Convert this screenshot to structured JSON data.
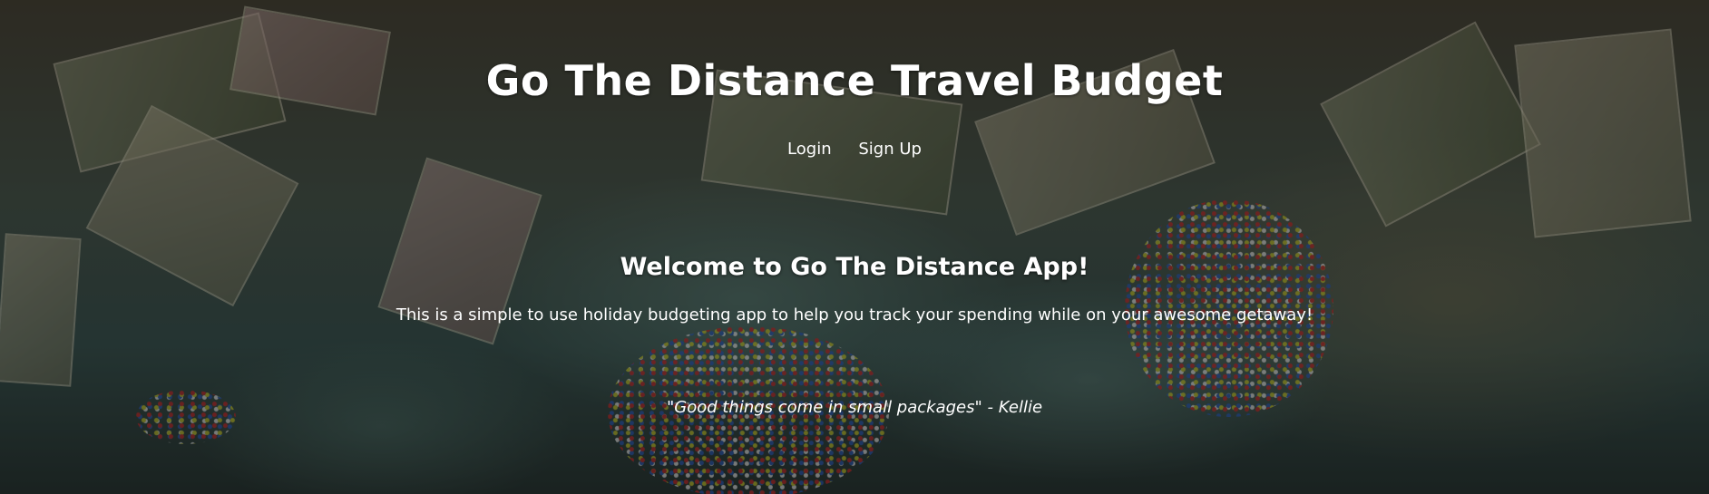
{
  "header": {
    "title": "Go The Distance Travel Budget"
  },
  "nav": {
    "login_label": "Login",
    "signup_label": "Sign Up"
  },
  "main": {
    "welcome_heading": "Welcome to Go The Distance App!",
    "description": "This is a simple to use holiday budgeting app to help you track your spending while on your awesome getaway!",
    "quote": "\"Good things come in small packages\" - Kellie"
  }
}
